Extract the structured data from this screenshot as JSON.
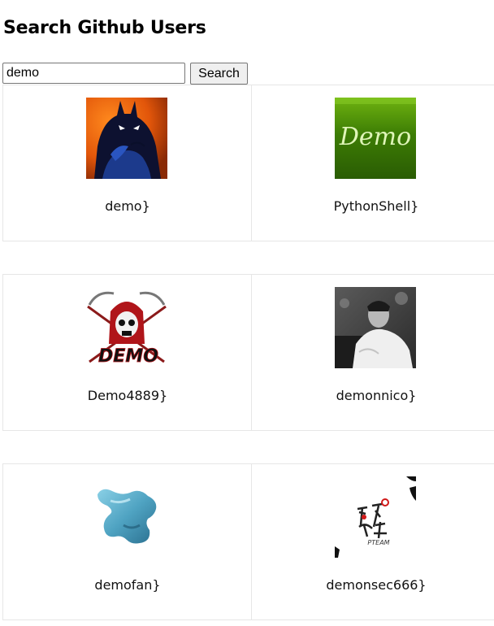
{
  "header": {
    "title": "Search Github Users"
  },
  "search": {
    "value": "demo",
    "button_label": "Search"
  },
  "results": [
    {
      "label": "demo}",
      "avatar": "batman-avatar"
    },
    {
      "label": "PythonShell}",
      "avatar": "green-demo-avatar",
      "avatar_text": "Demo"
    },
    {
      "label": "Demo4889}",
      "avatar": "skull-demo-avatar",
      "avatar_text": "DEMO"
    },
    {
      "label": "demonnico}",
      "avatar": "photo-avatar"
    },
    {
      "label": "demofan}",
      "avatar": "blue-shape-avatar"
    },
    {
      "label": "demonsec666}",
      "avatar": "calligraphy-avatar",
      "avatar_text": "PTEAM"
    }
  ]
}
